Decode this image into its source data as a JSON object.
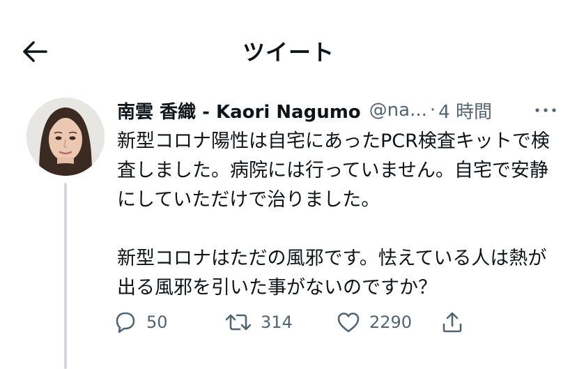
{
  "header": {
    "title": "ツイート",
    "back_icon": "arrow-left-icon"
  },
  "tweet": {
    "author": {
      "display_name": "南雲 香織 - Kaori Nagumo",
      "handle": "@na...",
      "avatar": "avatar-photo"
    },
    "separator": "·",
    "timestamp": "4 時間",
    "more_icon": "more-horizontal-icon",
    "paragraphs": [
      "新型コロナ陽性は自宅にあったPCR検査キットで検査しました。病院には行っていません。自宅で安静にしていただけで治りました。",
      "新型コロナはただの風邪です。怯えている人は熱が出る風邪を引いた事がないのですか？"
    ],
    "actions": {
      "reply": {
        "icon": "reply-icon",
        "count": "50"
      },
      "retweet": {
        "icon": "retweet-icon",
        "count": "314"
      },
      "like": {
        "icon": "heart-icon",
        "count": "2290"
      },
      "share": {
        "icon": "share-icon"
      }
    }
  },
  "colors": {
    "text": "#0f1419",
    "secondary": "#536471",
    "thread_line": "#cfd9de",
    "background": "#ffffff"
  }
}
